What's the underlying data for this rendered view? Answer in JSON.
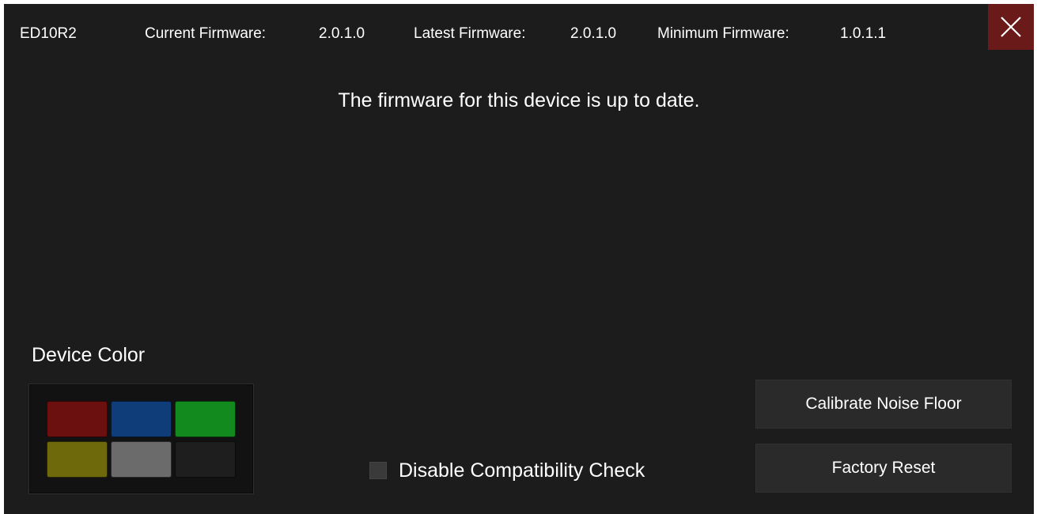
{
  "header": {
    "device_name": "ED10R2",
    "current_firmware_label": "Current Firmware:",
    "current_firmware_value": "2.0.1.0",
    "latest_firmware_label": "Latest Firmware:",
    "latest_firmware_value": "2.0.1.0",
    "minimum_firmware_label": "Minimum Firmware:",
    "minimum_firmware_value": "1.0.1.1",
    "close_icon": "close-icon"
  },
  "status_message": "The firmware for this device is up to date.",
  "device_color": {
    "label": "Device Color",
    "swatches": [
      {
        "name": "red",
        "color": "#6b0f0f"
      },
      {
        "name": "blue",
        "color": "#0f3d7a"
      },
      {
        "name": "green",
        "color": "#128a1e"
      },
      {
        "name": "yellow",
        "color": "#6e6a0b"
      },
      {
        "name": "gray",
        "color": "#6b6b6b"
      },
      {
        "name": "black",
        "color": "#1e1e1e"
      }
    ]
  },
  "compatibility_check": {
    "label": "Disable Compatibility Check",
    "checked": false
  },
  "buttons": {
    "calibrate_label": "Calibrate Noise Floor",
    "factory_reset_label": "Factory Reset"
  },
  "colors": {
    "background": "#1c1c1c",
    "close_button": "#6b1a1a",
    "button_bg": "#2a2a2a"
  }
}
